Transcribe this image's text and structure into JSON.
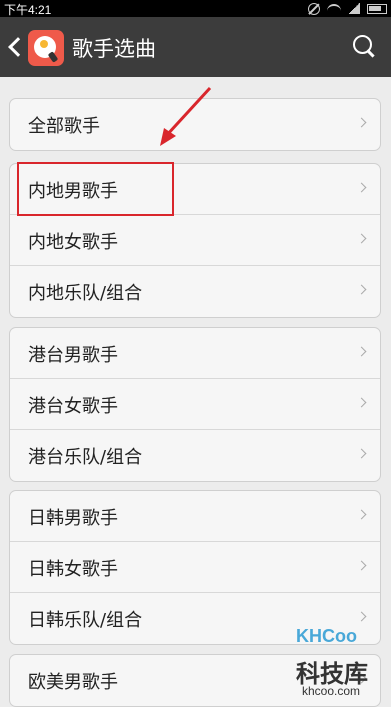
{
  "status_bar": {
    "time": "下午4:21"
  },
  "header": {
    "title": "歌手选曲"
  },
  "groups": [
    {
      "items": [
        {
          "label": "全部歌手"
        }
      ]
    },
    {
      "items": [
        {
          "label": "内地男歌手"
        },
        {
          "label": "内地女歌手"
        },
        {
          "label": "内地乐队/组合"
        }
      ]
    },
    {
      "items": [
        {
          "label": "港台男歌手"
        },
        {
          "label": "港台女歌手"
        },
        {
          "label": "港台乐队/组合"
        }
      ]
    },
    {
      "items": [
        {
          "label": "日韩男歌手"
        },
        {
          "label": "日韩女歌手"
        },
        {
          "label": "日韩乐队/组合"
        }
      ]
    },
    {
      "items": [
        {
          "label": "欧美男歌手"
        }
      ]
    }
  ],
  "annotation": {
    "color": "#d9262c"
  },
  "watermark": {
    "brand": "KHCoo",
    "name": "科技库",
    "url": "khcoo.com"
  }
}
